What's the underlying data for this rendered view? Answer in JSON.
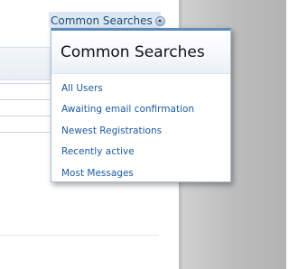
{
  "trigger": {
    "label": "Common Searches",
    "icon": "collapse-arrow-up-icon"
  },
  "menu": {
    "title": "Common Searches",
    "items": [
      {
        "label": "All Users"
      },
      {
        "label": "Awaiting email confirmation"
      },
      {
        "label": "Newest Registrations"
      },
      {
        "label": "Recently active"
      },
      {
        "label": "Most Messages"
      }
    ]
  },
  "colors": {
    "link": "#1d5aa0",
    "trigger_text": "#1d4d7d",
    "menu_border_accent": "#5b8cbc",
    "gutter": "#c4c4c4"
  }
}
